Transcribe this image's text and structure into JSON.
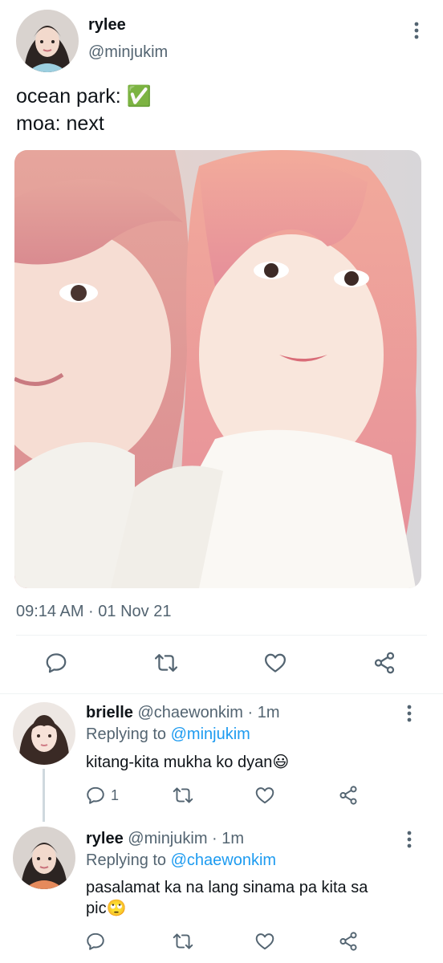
{
  "tweet": {
    "display_name": "rylee",
    "handle": "@minjukim",
    "text_line1": "ocean park: ✅",
    "text_line2": "moa: next",
    "timestamp": "09:14 AM · 01 Nov 21",
    "photo_alt": "Selfie of two people with pink hair"
  },
  "replies": [
    {
      "display_name": "brielle",
      "handle": "@chaewonkim",
      "time": "· 1m",
      "replying_prefix": "Replying to",
      "replying_to": "@minjukim",
      "text": "kitang-kita mukha ko dyan😃",
      "reply_count": "1"
    },
    {
      "display_name": "rylee",
      "handle": "@minjukim",
      "time": "· 1m",
      "replying_prefix": "Replying to",
      "replying_to": "@chaewonkim",
      "text_line1": "pasalamat ka na lang sinama pa kita sa",
      "text_line2": "pic🙄",
      "reply_count": ""
    }
  ],
  "icons": {
    "reply": "reply-icon",
    "retweet": "retweet-icon",
    "like": "like-icon",
    "share": "share-icon",
    "more": "more-icon"
  },
  "colors": {
    "accent": "#1d9bf0",
    "text": "#0f1419",
    "muted": "#536471",
    "divider": "#eff3f4"
  }
}
